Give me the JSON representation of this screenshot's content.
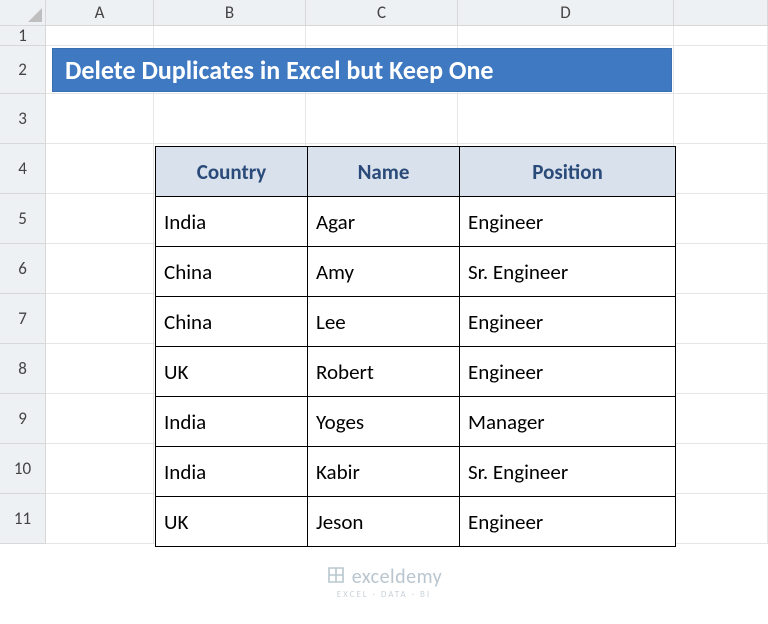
{
  "columns": [
    "",
    "A",
    "B",
    "C",
    "D",
    ""
  ],
  "rows": [
    "1",
    "2",
    "3",
    "4",
    "5",
    "6",
    "7",
    "8",
    "9",
    "10",
    "11"
  ],
  "title": "Delete Duplicates in Excel but Keep One",
  "table": {
    "headers": {
      "country": "Country",
      "name": "Name",
      "position": "Position"
    },
    "data": [
      {
        "country": "India",
        "name": "Agar",
        "position": "Engineer"
      },
      {
        "country": "China",
        "name": "Amy",
        "position": "Sr. Engineer"
      },
      {
        "country": "China",
        "name": "Lee",
        "position": "Engineer"
      },
      {
        "country": "UK",
        "name": "Robert",
        "position": "Engineer"
      },
      {
        "country": "India",
        "name": "Yoges",
        "position": "Manager"
      },
      {
        "country": "India",
        "name": "Kabir",
        "position": "Sr. Engineer"
      },
      {
        "country": "UK",
        "name": "Jeson",
        "position": "Engineer"
      }
    ]
  },
  "watermark": {
    "brand": "exceldemy",
    "tagline": "EXCEL · DATA · BI"
  },
  "chart_data": {
    "type": "table",
    "title": "Delete Duplicates in Excel but Keep One",
    "columns": [
      "Country",
      "Name",
      "Position"
    ],
    "rows": [
      [
        "India",
        "Agar",
        "Engineer"
      ],
      [
        "China",
        "Amy",
        "Sr. Engineer"
      ],
      [
        "China",
        "Lee",
        "Engineer"
      ],
      [
        "UK",
        "Robert",
        "Engineer"
      ],
      [
        "India",
        "Yoges",
        "Manager"
      ],
      [
        "India",
        "Kabir",
        "Sr. Engineer"
      ],
      [
        "UK",
        "Jeson",
        "Engineer"
      ]
    ]
  }
}
